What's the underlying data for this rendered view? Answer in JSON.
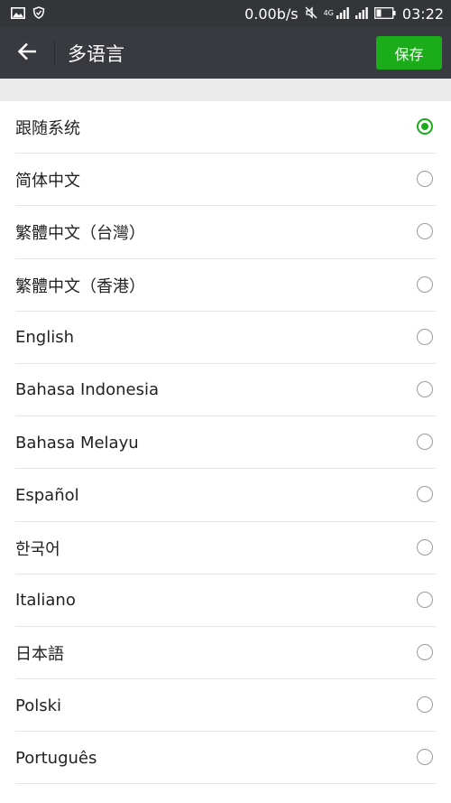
{
  "status_bar": {
    "speed": "0.00b/s",
    "network": "4G",
    "time": "03:22",
    "icons": [
      "image-icon",
      "shield-icon",
      "mute-icon",
      "signal-icon",
      "signal-icon",
      "battery-icon"
    ]
  },
  "header": {
    "title": "多语言",
    "save_label": "保存",
    "back_icon": "arrow-left-icon"
  },
  "colors": {
    "header_bg": "#393a3f",
    "status_bg": "#333538",
    "accent": "#1aad19"
  },
  "languages": [
    {
      "label": "跟随系统",
      "selected": true
    },
    {
      "label": "简体中文",
      "selected": false
    },
    {
      "label": "繁體中文（台灣）",
      "selected": false
    },
    {
      "label": "繁體中文（香港）",
      "selected": false
    },
    {
      "label": "English",
      "selected": false
    },
    {
      "label": "Bahasa Indonesia",
      "selected": false
    },
    {
      "label": "Bahasa Melayu",
      "selected": false
    },
    {
      "label": "Español",
      "selected": false
    },
    {
      "label": "한국어",
      "selected": false
    },
    {
      "label": "Italiano",
      "selected": false
    },
    {
      "label": "日本語",
      "selected": false
    },
    {
      "label": "Polski",
      "selected": false
    },
    {
      "label": "Português",
      "selected": false
    }
  ]
}
